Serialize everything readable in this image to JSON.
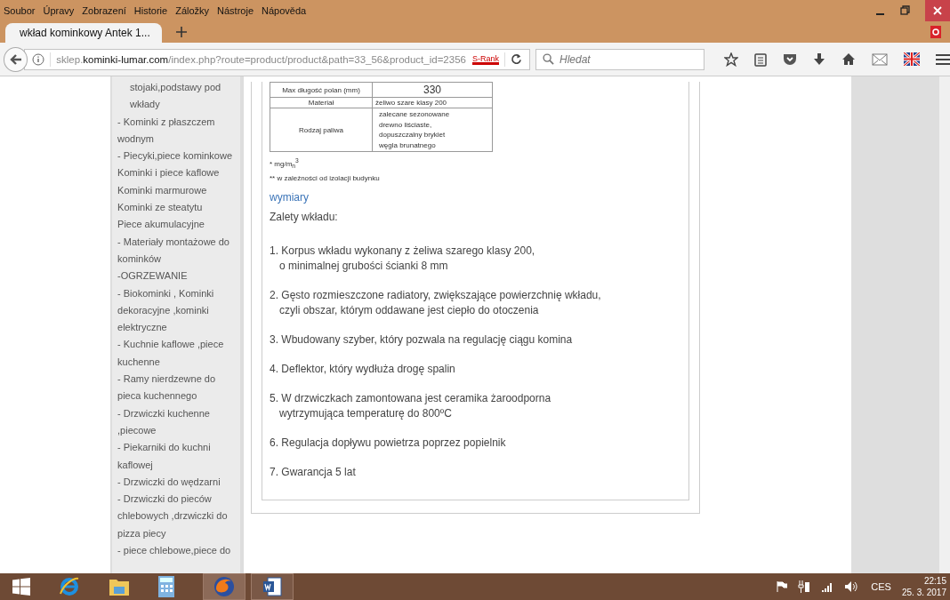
{
  "menu": [
    "Soubor",
    "Úpravy",
    "Zobrazení",
    "Historie",
    "Záložky",
    "Nástroje",
    "Nápověda"
  ],
  "tabs": [
    {
      "title": "wkład kominkowy Antek 1...",
      "selected": true
    }
  ],
  "address": {
    "prefix": "sklep.",
    "domain": "kominki-lumar.com",
    "path": "/index.php?route=product/product&path=33_56&product_id=2356"
  },
  "srank": "S-Rank",
  "search": {
    "placeholder": "Hledat"
  },
  "sidebar": [
    {
      "text": "stojaki,podstawy pod wkłady",
      "indent": true
    },
    {
      "text": "- Kominki z płaszczem wodnym",
      "indent": false
    },
    {
      "text": "- Piecyki,piece kominkowe",
      "indent": false
    },
    {
      "text": "Kominki i piece kaflowe",
      "indent": false
    },
    {
      "text": "Kominki marmurowe",
      "indent": false
    },
    {
      "text": "Kominki ze steatytu",
      "indent": false
    },
    {
      "text": "Piece akumulacyjne",
      "indent": false
    },
    {
      "text": "- Materiały montażowe do kominków",
      "indent": false
    },
    {
      "text": "-OGRZEWANIE",
      "indent": false
    },
    {
      "text": "- Biokominki , Kominki dekoracyjne ,kominki elektryczne",
      "indent": false
    },
    {
      "text": "- Kuchnie kaflowe ,piece kuchenne",
      "indent": false
    },
    {
      "text": "- Ramy nierdzewne do pieca kuchennego",
      "indent": false
    },
    {
      "text": "- Drzwiczki kuchenne ,piecowe",
      "indent": false
    },
    {
      "text": "- Piekarniki do kuchni kaflowej",
      "indent": false
    },
    {
      "text": "- Drzwiczki do wędzarni",
      "indent": false
    },
    {
      "text": "- Drzwiczki do pieców chlebowych ,drzwiczki do pizza piecy",
      "indent": false
    },
    {
      "text": "- piece chlebowe,piece do",
      "indent": false
    }
  ],
  "table": {
    "rows": [
      {
        "label": "Max długość polan (mm)",
        "value": "330",
        "large": true
      },
      {
        "label": "Materiał",
        "value": "żeliwo szare klasy 200",
        "large": false
      },
      {
        "label": "Rodzaj paliwa",
        "value": [
          "zalecane sezonowane",
          "drewno liściaste,",
          "dopuszczalny brykiet",
          " węgla brunatnego"
        ],
        "large": false
      }
    ]
  },
  "footnotes": [
    "* mg/m$_{n}$$^{3}$",
    "** w zależności od izolacji budynku"
  ],
  "link": "wymiary",
  "heading": "Zalety wkładu:",
  "features": [
    [
      "1. Korpus wkładu wykonany z żeliwa szarego klasy 200,",
      "o minimalnej grubości ścianki 8 mm"
    ],
    [
      "2. Gęsto rozmieszczone radiatory, zwiększające powierzchnię wkładu,",
      "czyli obszar, którym oddawane jest ciepło do otoczenia"
    ],
    [
      "3. Wbudowany szyber, który pozwala na regulację ciągu komina"
    ],
    [
      "4. Deflektor, który wydłuża drogę spalin"
    ],
    [
      "5. W drzwiczkach zamontowana jest ceramika żaroodporna",
      "wytrzymująca temperaturę do 800ºC"
    ],
    [
      "6. Regulacja dopływu powietrza poprzez popielnik"
    ],
    [
      "7. Gwarancja 5 lat"
    ]
  ],
  "tray": {
    "lang": "CES",
    "time": "22:15",
    "date": "25. 3. 2017"
  }
}
